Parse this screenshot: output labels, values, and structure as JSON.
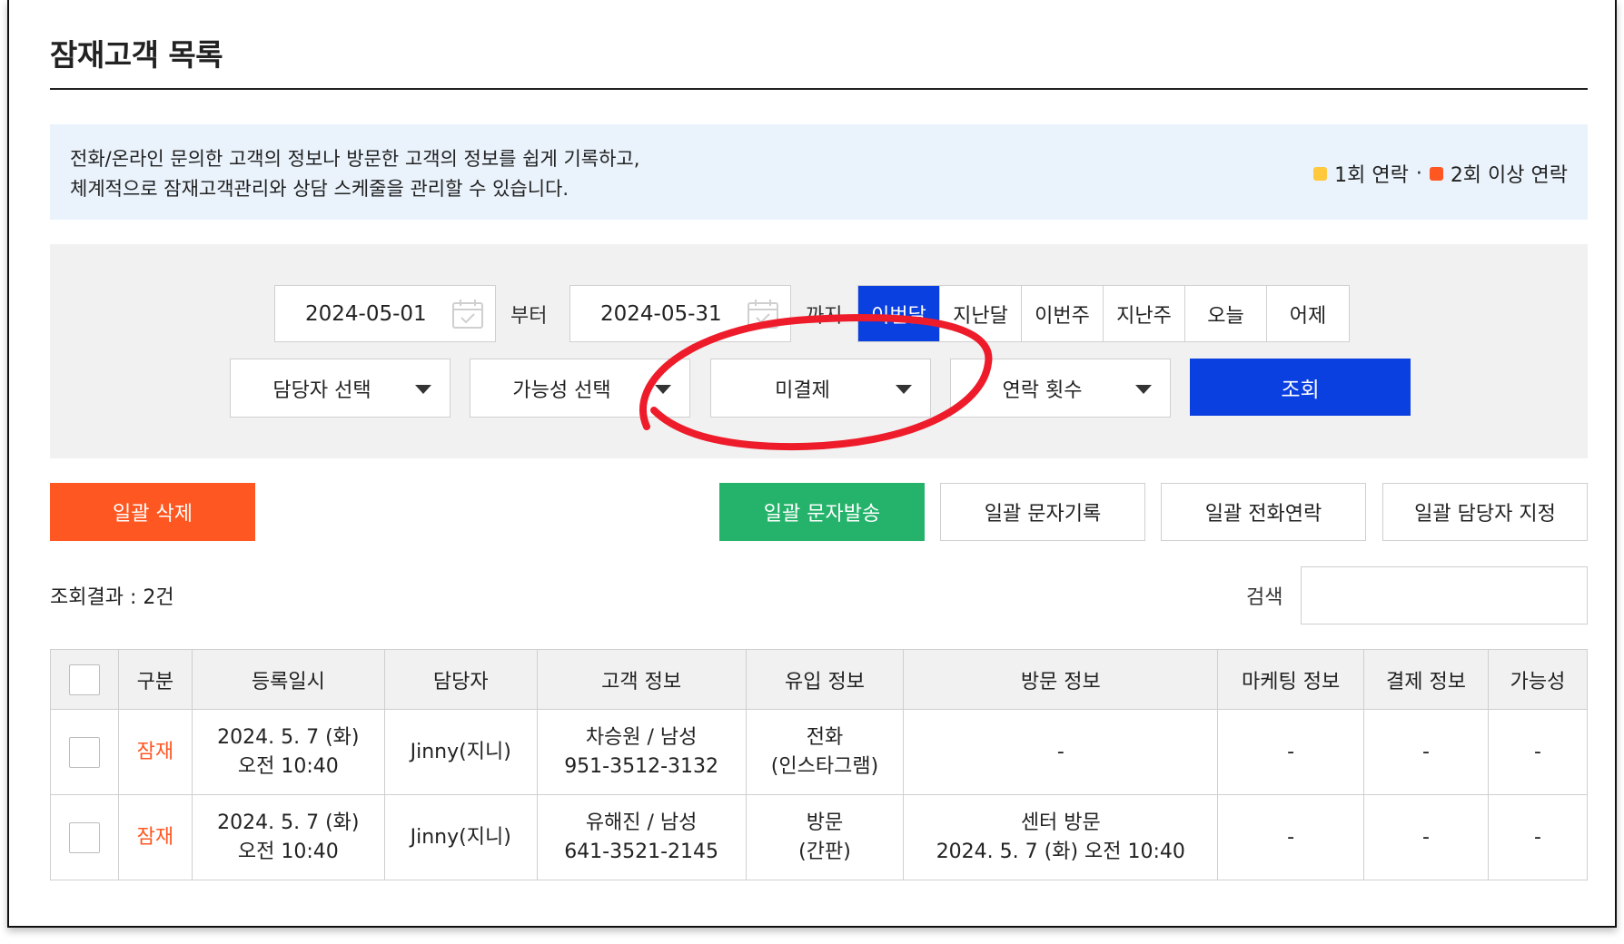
{
  "page": {
    "title": "잠재고객 목록"
  },
  "info": {
    "line1": "전화/온라인 문의한 고객의 정보나 방문한 고객의 정보를 쉽게 기록하고,",
    "line2": "체계적으로 잠재고객관리와 상담 스케줄을 관리할 수 있습니다.",
    "legend_one": "1회 연락",
    "legend_sep": "·",
    "legend_two": "2회 이상 연락",
    "legend_one_color": "#ffc83d",
    "legend_two_color": "#ff5722"
  },
  "filters": {
    "start_date": "2024-05-01",
    "from_label": "부터",
    "end_date": "2024-05-31",
    "to_label": "까지",
    "periods": [
      "이번달",
      "지난달",
      "이번주",
      "지난주",
      "오늘",
      "어제"
    ],
    "active_period": "이번달",
    "manager_select": "담당자 선택",
    "possibility_select": "가능성 선택",
    "payment_select": "미결제",
    "contact_select": "연락 횟수",
    "search_button": "조회",
    "primary_color": "#0a3fe0"
  },
  "actions": {
    "bulk_delete": "일괄 삭제",
    "bulk_sms_send": "일괄 문자발송",
    "bulk_sms_record": "일괄 문자기록",
    "bulk_call": "일괄 전화연락",
    "bulk_assign": "일괄 담당자 지정"
  },
  "results": {
    "count_label": "조회결과 : 2건",
    "search_label": "검색",
    "search_value": ""
  },
  "table": {
    "headers": [
      "구분",
      "등록일시",
      "담당자",
      "고객 정보",
      "유입 정보",
      "방문 정보",
      "마케팅 정보",
      "결제 정보",
      "가능성"
    ],
    "rows": [
      {
        "type": "잠재",
        "date": "2024. 5. 7 (화)",
        "time": "오전 10:40",
        "manager": "Jinny(지니)",
        "customer": "차승원 / 남성",
        "phone": "951-3512-3132",
        "source": "전화",
        "source_detail": "(인스타그램)",
        "visit": "-",
        "visit_detail": "",
        "marketing": "-",
        "payment": "-",
        "possibility": "-"
      },
      {
        "type": "잠재",
        "date": "2024. 5. 7 (화)",
        "time": "오전 10:40",
        "manager": "Jinny(지니)",
        "customer": "유해진 / 남성",
        "phone": "641-3521-2145",
        "source": "방문",
        "source_detail": "(간판)",
        "visit": "센터 방문",
        "visit_detail": "2024. 5. 7 (화) 오전 10:40",
        "marketing": "-",
        "payment": "-",
        "possibility": "-"
      }
    ]
  }
}
